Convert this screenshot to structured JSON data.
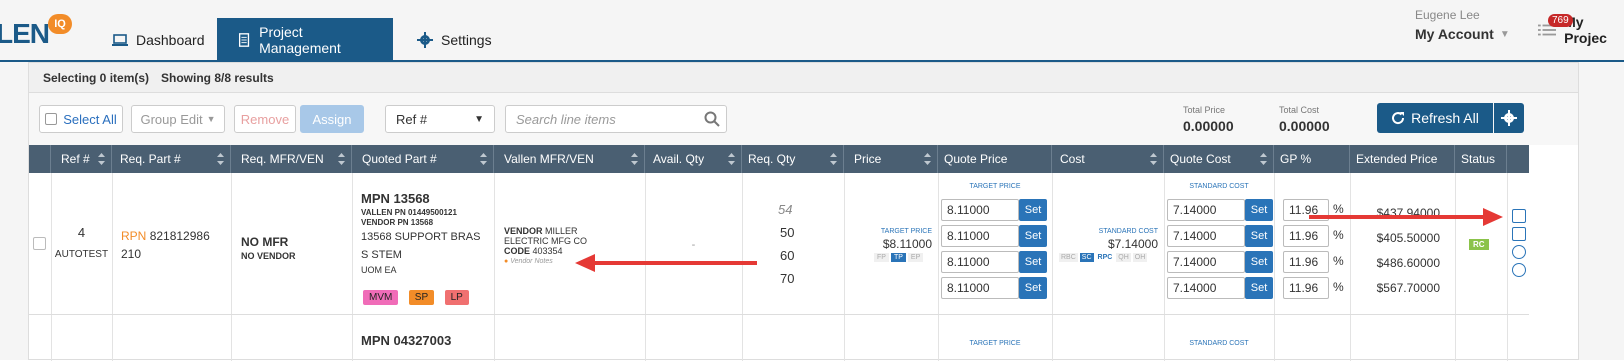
{
  "header": {
    "logo_text": "LEN",
    "logo_badge": "IQ",
    "tabs": [
      {
        "label": "Dashboard"
      },
      {
        "label": "Project Management"
      },
      {
        "label": "Settings"
      }
    ],
    "user_name": "Eugene Lee",
    "account_label": "My Account",
    "notif_count": "769",
    "my_projects": "My Projec"
  },
  "selection": {
    "selecting": "Selecting 0 item(s)",
    "showing": "Showing 8/8 results"
  },
  "toolbar": {
    "select_all": "Select All",
    "group_edit": "Group Edit",
    "remove": "Remove",
    "assign": "Assign",
    "ref_select": "Ref #",
    "search_placeholder": "Search line items",
    "total_price_label": "Total Price",
    "total_price": "0.00000",
    "total_cost_label": "Total Cost",
    "total_cost": "0.00000",
    "refresh": "Refresh All"
  },
  "columns": [
    "Ref #",
    "Req. Part #",
    "Req. MFR/VEN",
    "Quoted Part #",
    "Vallen MFR/VEN",
    "Avail. Qty",
    "Req. Qty",
    "Price",
    "Quote Price",
    "Cost",
    "Quote Cost",
    "GP %",
    "Extended Price",
    "Status"
  ],
  "row1": {
    "ref": "4",
    "ref_sub": "AUTOTEST",
    "rpn_label": "RPN",
    "rpn_value": "821812986",
    "rpn_value2": "210",
    "mfr": "NO MFR",
    "vendor": "NO VENDOR",
    "mpn": "MPN 13568",
    "vallen_pn": "VALLEN PN 01449500121",
    "vendor_pn": "VENDOR PN 13568",
    "desc1": "13568 SUPPORT BRAS",
    "desc2": "S STEM",
    "uom": "UOM EA",
    "tags": [
      "MVM",
      "SP",
      "LP"
    ],
    "vendor_label": "VENDOR",
    "vendor_name": "MILLER",
    "vendor_name2": "ELECTRIC MFG CO",
    "code_label": "CODE",
    "code_value": "403354",
    "vendor_notes": "Vendor Notes",
    "avail": "-",
    "req_qty_head": "54",
    "req_qtys": [
      "50",
      "60",
      "70"
    ],
    "target_price_label": "TARGET PRICE",
    "target_price": "$8.11000",
    "price_modes": [
      "FP",
      "TP",
      "EP"
    ],
    "quote_prices": [
      "8.11000",
      "8.11000",
      "8.11000",
      "8.11000"
    ],
    "set_label": "Set",
    "standard_cost_label": "STANDARD COST",
    "standard_cost": "$7.14000",
    "cost_modes": [
      "RBC",
      "SC",
      "RPC",
      "QH",
      "OH"
    ],
    "quote_costs": [
      "7.14000",
      "7.14000",
      "7.14000",
      "7.14000"
    ],
    "gps": [
      "11.96",
      "11.96",
      "11.96",
      "11.96"
    ],
    "pct": "%",
    "extended": [
      "$437.94000",
      "$405.50000",
      "$486.60000",
      "$567.70000"
    ],
    "status": "RC"
  },
  "row2": {
    "mpn": "MPN 04327003",
    "target_price_label": "TARGET PRICE",
    "standard_cost_label": "STANDARD COST"
  }
}
